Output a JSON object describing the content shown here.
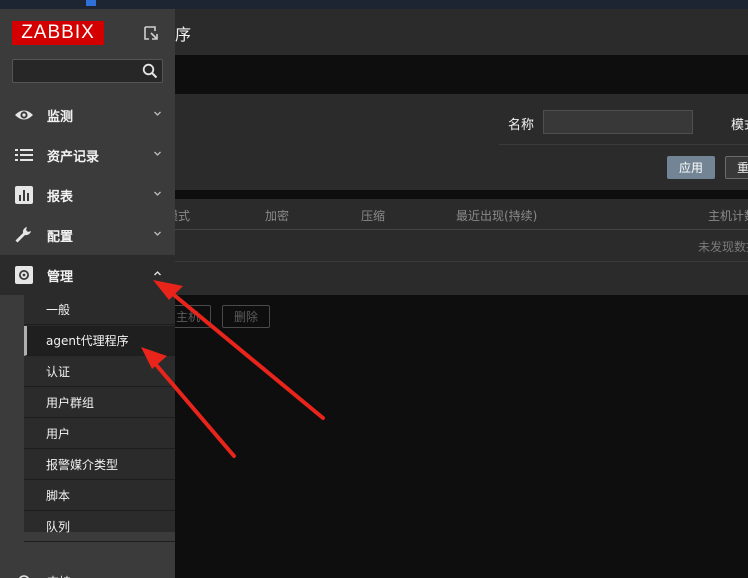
{
  "header": {
    "title_fragment": "序"
  },
  "sidebar": {
    "logo_text": "ZABBIX",
    "search": {
      "value": "",
      "placeholder": ""
    },
    "nav": [
      {
        "label": "监测",
        "icon": "eye-icon"
      },
      {
        "label": "资产记录",
        "icon": "list-icon"
      },
      {
        "label": "报表",
        "icon": "bar-chart-icon"
      },
      {
        "label": "配置",
        "icon": "wrench-icon"
      },
      {
        "label": "管理",
        "icon": "gear-icon"
      }
    ],
    "admin_submenu": [
      {
        "label": "一般"
      },
      {
        "label": "agent代理程序"
      },
      {
        "label": "认证"
      },
      {
        "label": "用户群组"
      },
      {
        "label": "用户"
      },
      {
        "label": "报警媒介类型"
      },
      {
        "label": "脚本"
      },
      {
        "label": "队列"
      }
    ],
    "support": {
      "label": "支持",
      "icon": "headset-icon"
    }
  },
  "filter": {
    "name_label": "名称",
    "name_value": "",
    "mode_label": "模式",
    "apply_label": "应用",
    "reset_label": "重设"
  },
  "table": {
    "columns": [
      "模式",
      "加密",
      "压缩",
      "最近出现(持续)",
      "主机计数"
    ],
    "empty_text": "未发现数据"
  },
  "actions": {
    "host_label": "主机",
    "delete_label": "删除"
  },
  "colors": {
    "logo_red": "#d40000",
    "apply_blue": "#738594",
    "arrow_red": "#e8241b"
  }
}
